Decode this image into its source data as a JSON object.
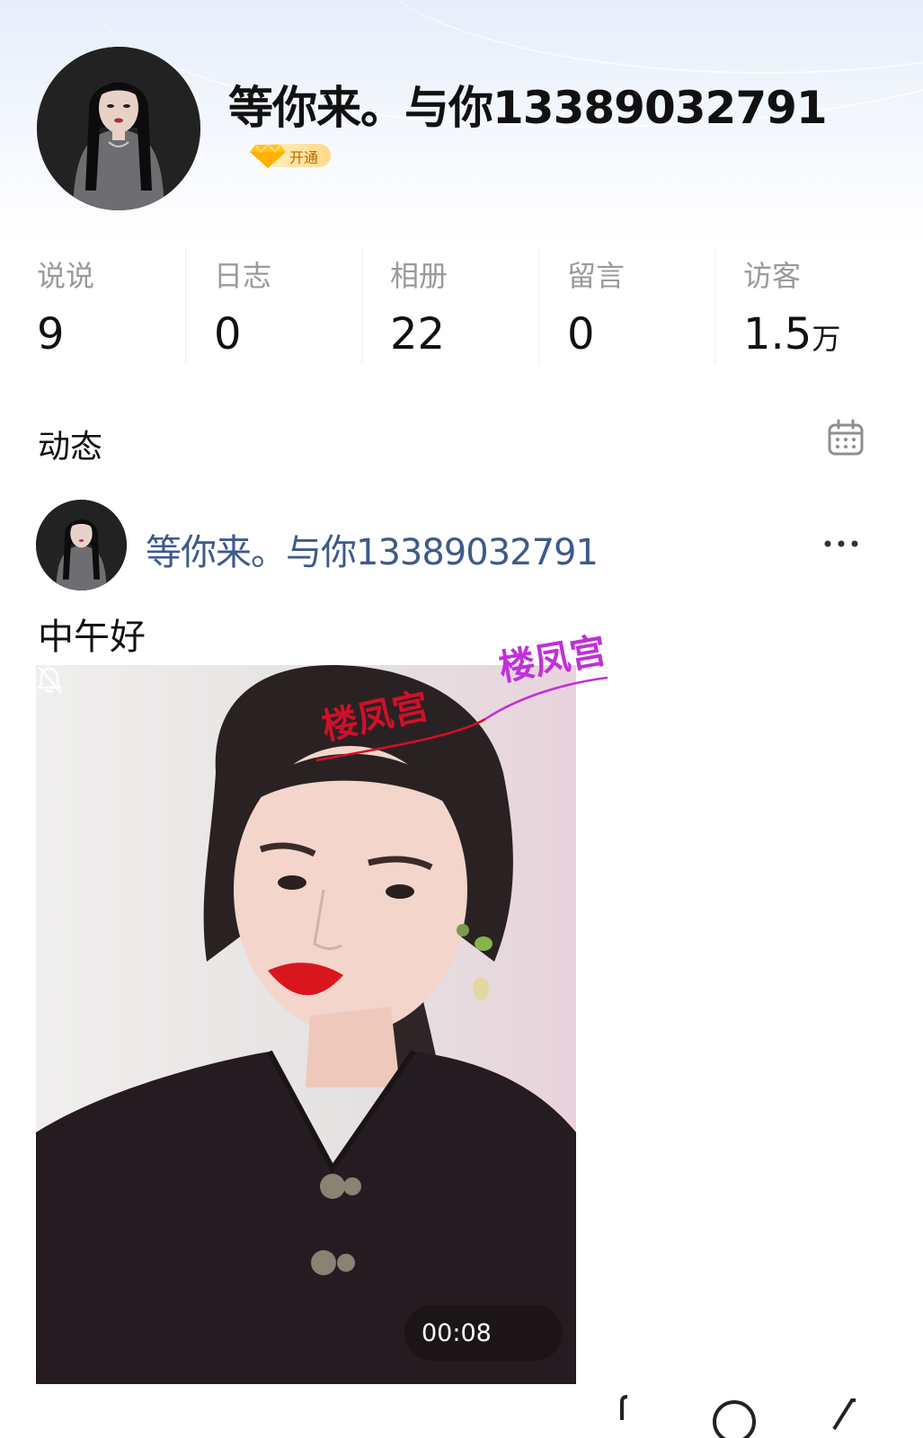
{
  "profile": {
    "name": "等你来。与你13389032791",
    "vip_label": "开通"
  },
  "stats": [
    {
      "label": "说说",
      "value": "9",
      "unit": ""
    },
    {
      "label": "日志",
      "value": "0",
      "unit": ""
    },
    {
      "label": "相册",
      "value": "22",
      "unit": ""
    },
    {
      "label": "留言",
      "value": "0",
      "unit": ""
    },
    {
      "label": "访客",
      "value": "1.5",
      "unit": "万"
    }
  ],
  "feed": {
    "title": "动态",
    "calendar_icon": "calendar-icon",
    "post": {
      "author": "等你来。与你13389032791",
      "text": "中午好",
      "video_time": "00:08",
      "muted": true,
      "watermarks": [
        "楼凤宫",
        "楼凤宫"
      ]
    }
  },
  "colors": {
    "author_link": "#3e5a8c",
    "stat_label": "#9a9a9a",
    "watermark_red": "#d0102a",
    "watermark_purple": "#c030d8"
  }
}
